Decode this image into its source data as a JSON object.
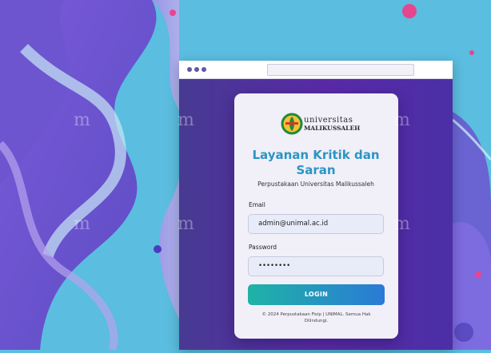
{
  "logo": {
    "line1": "universitas",
    "line2": "MALIKUSSALEH"
  },
  "heading": "Layanan Kritik dan Saran",
  "subtitle": "Perpustakaan Universitas Malikussaleh",
  "email": {
    "label": "Email",
    "value": "admin@unimal.ac.id"
  },
  "password": {
    "label": "Password",
    "value": "••••••••"
  },
  "login_label": "LOGIN",
  "footer": "© 2024 Perpustakaan Fisip | UNIMAL. Semua Hak Dilindungi."
}
